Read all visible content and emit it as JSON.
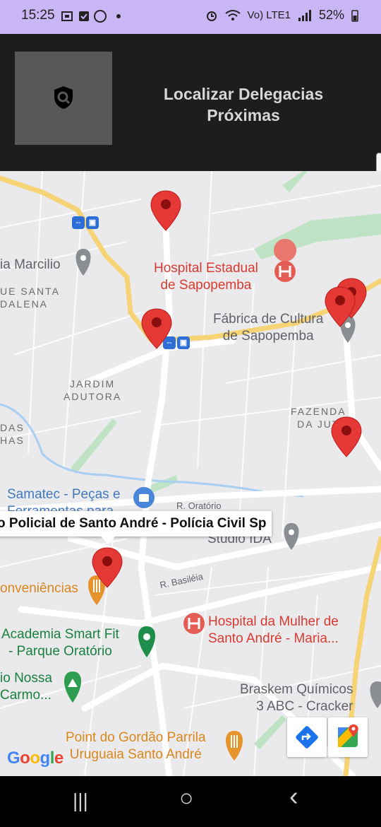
{
  "status_bar": {
    "time": "15:25",
    "left_icons": [
      "screen-record-icon",
      "checkbox-icon",
      "whatsapp-icon",
      "dot-icon"
    ],
    "network_label": "Vo) LTE1",
    "battery": "52%"
  },
  "header": {
    "title": "Localizar Delegacias\nPróximas",
    "logo_icon": "police-shield-icon"
  },
  "map": {
    "labels": {
      "hospital_sapopemba": "Hospital Estadual\nde Sapopemba",
      "fabrica": "Fábrica de Cultura\nde Sapopemba",
      "marcilio": "ia Marcilio",
      "santa_madalena": "UE SANTA\nDALENA",
      "jardim_adutora": "JARDIM\nADUTORA",
      "fazenda_juta": "FAZENDA\nDA JUT",
      "das_has": "DAS\nHAS",
      "samatec": "Samatec - Peças e\nFerramentas para",
      "r_oratorio": "R. Oratório",
      "studio_ida": "Studio IDA",
      "conveniencias": "onveniências",
      "r_basileia": "R. Basiléia",
      "hospital_mulher": "Hospital da Mulher de\nSanto André - Maria...",
      "academia": "Academia Smart Fit\n- Parque Oratório",
      "nossa_carmo": "io Nossa\nCarmo...",
      "braskem": "Braskem Químicos\n3 ABC - Cracker",
      "point_gordao": "Point do Gordão Parrila\nUruguaia Santo André"
    },
    "info_window": "o Policial de Santo André - Polícia Civil Sp",
    "google_logo": [
      "G",
      "o",
      "o",
      "g",
      "l",
      "e"
    ],
    "google_colors": [
      "#4285F4",
      "#EA4335",
      "#FBBC05",
      "#4285F4",
      "#34A853",
      "#EA4335"
    ],
    "marker_color": "#e53935",
    "buttons": {
      "directions_icon": "directions-icon",
      "maps_icon": "google-maps-icon"
    }
  },
  "nav_bar": {
    "recents": "|||",
    "home": "○",
    "back": "‹"
  }
}
